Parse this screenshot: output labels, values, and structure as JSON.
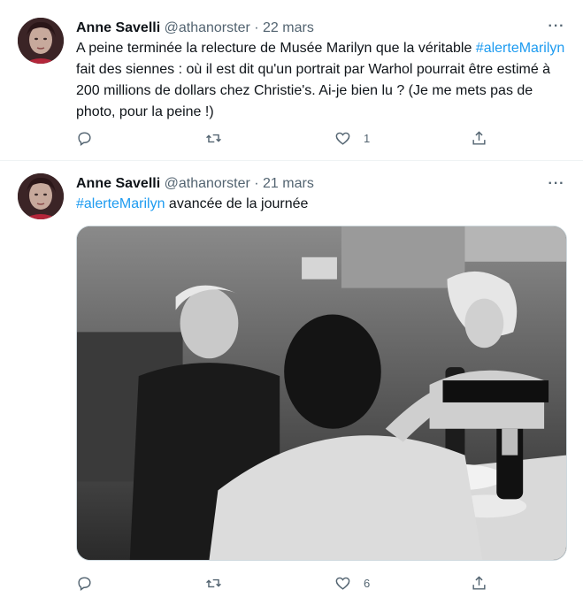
{
  "tweets": [
    {
      "author": {
        "name": "Anne Savelli",
        "handle": "@athanorster"
      },
      "separator": "·",
      "date": "22 mars",
      "text_before": "A peine terminée la relecture de Musée Marilyn que la véritable ",
      "hashtag": "#alerteMarilyn",
      "text_after": " fait des siennes : où il est dit qu'un portrait par Warhol pourrait être estimé à 200 millions de dollars chez Christie's. Ai-je bien lu ? (Je me mets pas de photo, pour la peine !)",
      "stats": {
        "replies": "",
        "retweets": "",
        "likes": "1"
      },
      "more_label": "···"
    },
    {
      "author": {
        "name": "Anne Savelli",
        "handle": "@athanorster"
      },
      "separator": "·",
      "date": "21 mars",
      "hashtag": "#alerteMarilyn",
      "text_after": " avancée de la journée",
      "stats": {
        "replies": "",
        "retweets": "",
        "likes": "6"
      },
      "more_label": "···"
    }
  ],
  "icons": {
    "reply": "reply-icon",
    "retweet": "retweet-icon",
    "like": "heart-icon",
    "share": "share-icon",
    "more": "more-icon"
  },
  "colors": {
    "hashtag": "#1d9bf0",
    "secondary_text": "#536471"
  }
}
